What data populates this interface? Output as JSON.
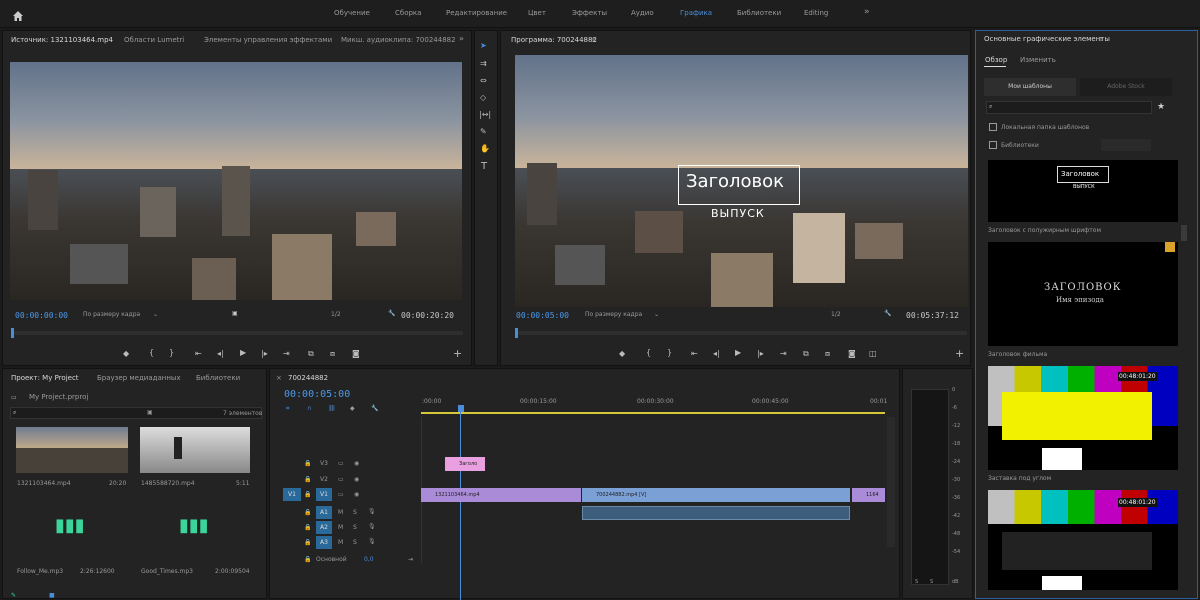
{
  "workspaces": [
    "Обучение",
    "Сборка",
    "Редактирование",
    "Цвет",
    "Эффекты",
    "Аудио",
    "Графика",
    "Библиотеки",
    "Editing"
  ],
  "source_panel": {
    "tabs": [
      "Источник: 1321103464.mp4",
      "Области Lumetri",
      "Элементы управления эффектами",
      "Микш. аудиоклипа: 700244882"
    ],
    "timecode": "00:00:00:00",
    "fit": "По размеру кадра",
    "resolution": "1/2",
    "duration": "00:00:20:20"
  },
  "program_panel": {
    "title": "Программа: 700244882",
    "timecode": "00:00:05:00",
    "fit": "По размеру кадра",
    "resolution": "1/2",
    "duration": "00:05:37:12",
    "title_overlay": "Заголовок",
    "subtitle_overlay": "ВЫПУСК"
  },
  "project_panel": {
    "tabs": [
      "Проект: My Project",
      "Браузер медиаданных",
      "Библиотеки"
    ],
    "file": "My Project.prproj",
    "count": "7 элементов",
    "items": [
      {
        "name": "1321103464.mp4",
        "dur": "20:20"
      },
      {
        "name": "1485588720.mp4",
        "dur": "5:11"
      },
      {
        "name": "Follow_Me.mp3",
        "dur": "2:26:12600"
      },
      {
        "name": "Good_Times.mp3",
        "dur": "2:00:09504"
      }
    ]
  },
  "timeline": {
    "tab": "700244882",
    "timecode": "00:00:05:00",
    "ruler": [
      ":00:00",
      "00:00:15:00",
      "00:00:30:00",
      "00:00:45:00",
      "00:01"
    ],
    "tracks": [
      "V3",
      "V2",
      "V1",
      "A1",
      "A2",
      "A3"
    ],
    "main_label": "Основной",
    "main_value": "0,0",
    "clips": {
      "title": "Заголо",
      "v1a": "1321103464.mp4",
      "v1b": "700244882.mp4 [V]",
      "v1c": "1164"
    }
  },
  "meter": {
    "labels": [
      "0",
      "-6",
      "-12",
      "-18",
      "-24",
      "-30",
      "-36",
      "-42",
      "-48",
      "-54",
      "dB"
    ],
    "bottom": [
      "S",
      "S"
    ]
  },
  "essential_graphics": {
    "title": "Основные графические элементы",
    "tabs": [
      "Обзор",
      "Изменить"
    ],
    "my_templates": "Мои шаблоны",
    "adobe_stock": "Adobe Stock",
    "local_folder": "Локальная папка шаблонов",
    "libraries": "Библиотеки",
    "templates": [
      {
        "name": "Заголовок с полужирным шрифтом",
        "line1": "Заголовок",
        "line2": "ВЫПУСК"
      },
      {
        "name": "Заголовок фильма",
        "line1": "ЗАГОЛОВОК",
        "line2": "Имя эпизода"
      },
      {
        "name": "Заставка под углом",
        "clock": "00:48:01:20"
      },
      {
        "name": "",
        "clock": "00:48:01:20"
      }
    ]
  },
  "colors": {
    "accent": "#4a8dd9",
    "clip_purple": "#a98bd8",
    "clip_blue": "#7aa0d6",
    "title_pink": "#e8a0e0",
    "audio_track": "#2a6a9a"
  }
}
